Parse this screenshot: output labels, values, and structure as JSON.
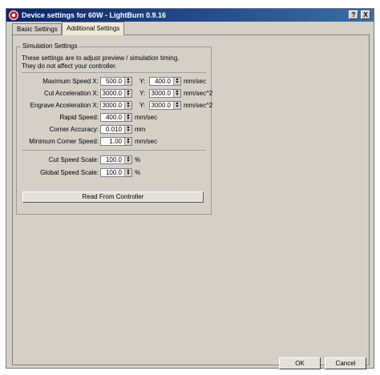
{
  "window": {
    "title": "Device settings for 60W - LightBurn 0.9.16"
  },
  "titlebar_buttons": {
    "help": "?",
    "close": "X"
  },
  "tabs": [
    {
      "label": "Basic Settings",
      "active": false
    },
    {
      "label": "Additional Settings",
      "active": true
    }
  ],
  "group": {
    "title": "Simulation Settings",
    "desc1": "These settings are to adjust preview / simulation timing.",
    "desc2": "They do not affect your controller."
  },
  "fields": {
    "max_speed": {
      "label": "Maximum Speed X:",
      "x": "500.0",
      "y_label": "Y:",
      "y": "400.0",
      "unit": "mm/sec"
    },
    "cut_accel": {
      "label": "Cut Acceleration X:",
      "x": "3000.0",
      "y_label": "Y:",
      "y": "3000.0",
      "unit": "mm/sec^2"
    },
    "engrave_accel": {
      "label": "Engrave Acceleration X:",
      "x": "3000.0",
      "y_label": "Y:",
      "y": "3000.0",
      "unit": "mm/sec^2"
    },
    "rapid_speed": {
      "label": "Rapid Speed:",
      "value": "400.0",
      "unit": "mm/sec"
    },
    "corner_accuracy": {
      "label": "Corner Accuracy:",
      "value": "0.010",
      "unit": "mm"
    },
    "min_corner_speed": {
      "label": "Minimum Corner Speed:",
      "value": "1.00",
      "unit": "mm/sec"
    },
    "cut_speed_scale": {
      "label": "Cut Speed Scale:",
      "value": "100.0",
      "unit": "%"
    },
    "global_speed_scale": {
      "label": "Global Speed Scale:",
      "value": "100.0",
      "unit": "%"
    }
  },
  "read_button": "Read From Controller",
  "buttons": {
    "ok": "OK",
    "cancel": "Cancel"
  }
}
